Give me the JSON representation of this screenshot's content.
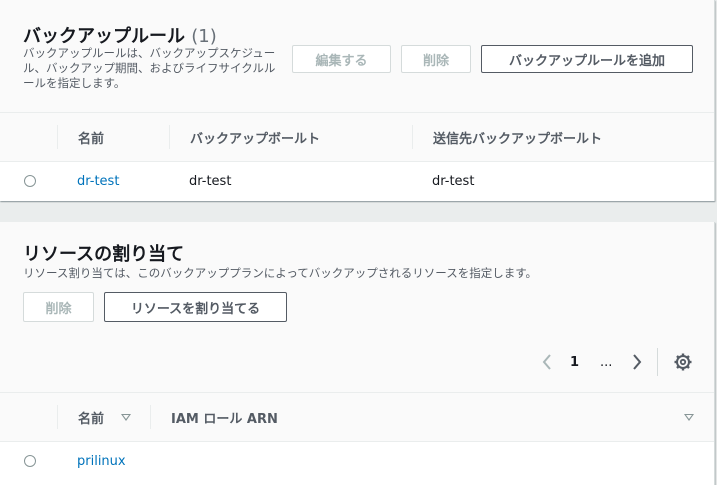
{
  "backup_rules": {
    "title": "バックアップルール",
    "count": "(1)",
    "description": "バックアップルールは、バックアップスケジュール、バックアップ期間、およびライフサイクルルールを指定します。",
    "buttons": {
      "edit": "編集する",
      "delete": "削除",
      "add": "バックアップルールを追加"
    },
    "columns": [
      "名前",
      "バックアップボールト",
      "送信先バックアップボールト"
    ],
    "rows": [
      {
        "name": "dr-test",
        "vault": "dr-test",
        "dest_vault": "dr-test"
      }
    ]
  },
  "resource_assignments": {
    "title": "リソースの割り当て",
    "description": "リソース割り当ては、このバックアッププランによってバックアップされるリソースを指定します。",
    "buttons": {
      "delete": "削除",
      "assign": "リソースを割り当てる"
    },
    "pagination": {
      "current_page": "1",
      "ellipsis": "..."
    },
    "columns": [
      "名前",
      "IAM ロール ARN"
    ],
    "rows": [
      {
        "name": "prilinux"
      }
    ]
  },
  "icons": [
    "chevron-left-icon",
    "chevron-right-icon",
    "gear-icon",
    "sort-caret-icon",
    "radio-icon"
  ],
  "colors": {
    "link": "#0073bb",
    "disabled": "#aab7b8",
    "background": "#eaeded"
  }
}
